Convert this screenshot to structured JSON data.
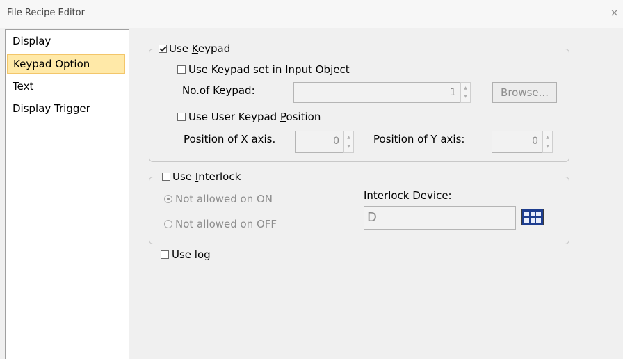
{
  "window": {
    "title": "File Recipe Editor",
    "close_glyph": "×"
  },
  "sidebar": {
    "items": [
      {
        "label": "Display",
        "selected": false
      },
      {
        "label": "Keypad Option",
        "selected": true
      },
      {
        "label": "Text",
        "selected": false
      },
      {
        "label": "Display Trigger",
        "selected": false
      }
    ]
  },
  "keypad": {
    "use_keypad": {
      "pre": "Use ",
      "key": "K",
      "post": "eypad",
      "checked": true
    },
    "use_input_object": {
      "pre": "",
      "key": "U",
      "post": "se Keypad set in Input Object",
      "checked": false
    },
    "no_of_keypad": {
      "key": "N",
      "post": "o.of Keypad:",
      "value": "1"
    },
    "browse": {
      "key": "B",
      "post": "rowse..."
    },
    "use_user_position": {
      "pre": "Use User Keypad ",
      "key": "P",
      "post": "osition",
      "checked": false
    },
    "x_axis": {
      "label": "Position of X axis.",
      "value": "0"
    },
    "y_axis": {
      "label": "Position of Y axis:",
      "value": "0"
    }
  },
  "interlock": {
    "use_interlock": {
      "pre": "Use ",
      "key": "I",
      "post": "nterlock",
      "checked": false
    },
    "not_allowed_on": {
      "label": "Not allowed on ON",
      "selected": true
    },
    "not_allowed_off": {
      "label": "Not allowed on OFF",
      "selected": false
    },
    "device_label": "Interlock Device:",
    "device_value": "D"
  },
  "use_log": {
    "label": "Use log",
    "checked": false
  },
  "colors": {
    "selected_bg": "#ffe9a8",
    "icon_blue": "#1d3d8f"
  }
}
